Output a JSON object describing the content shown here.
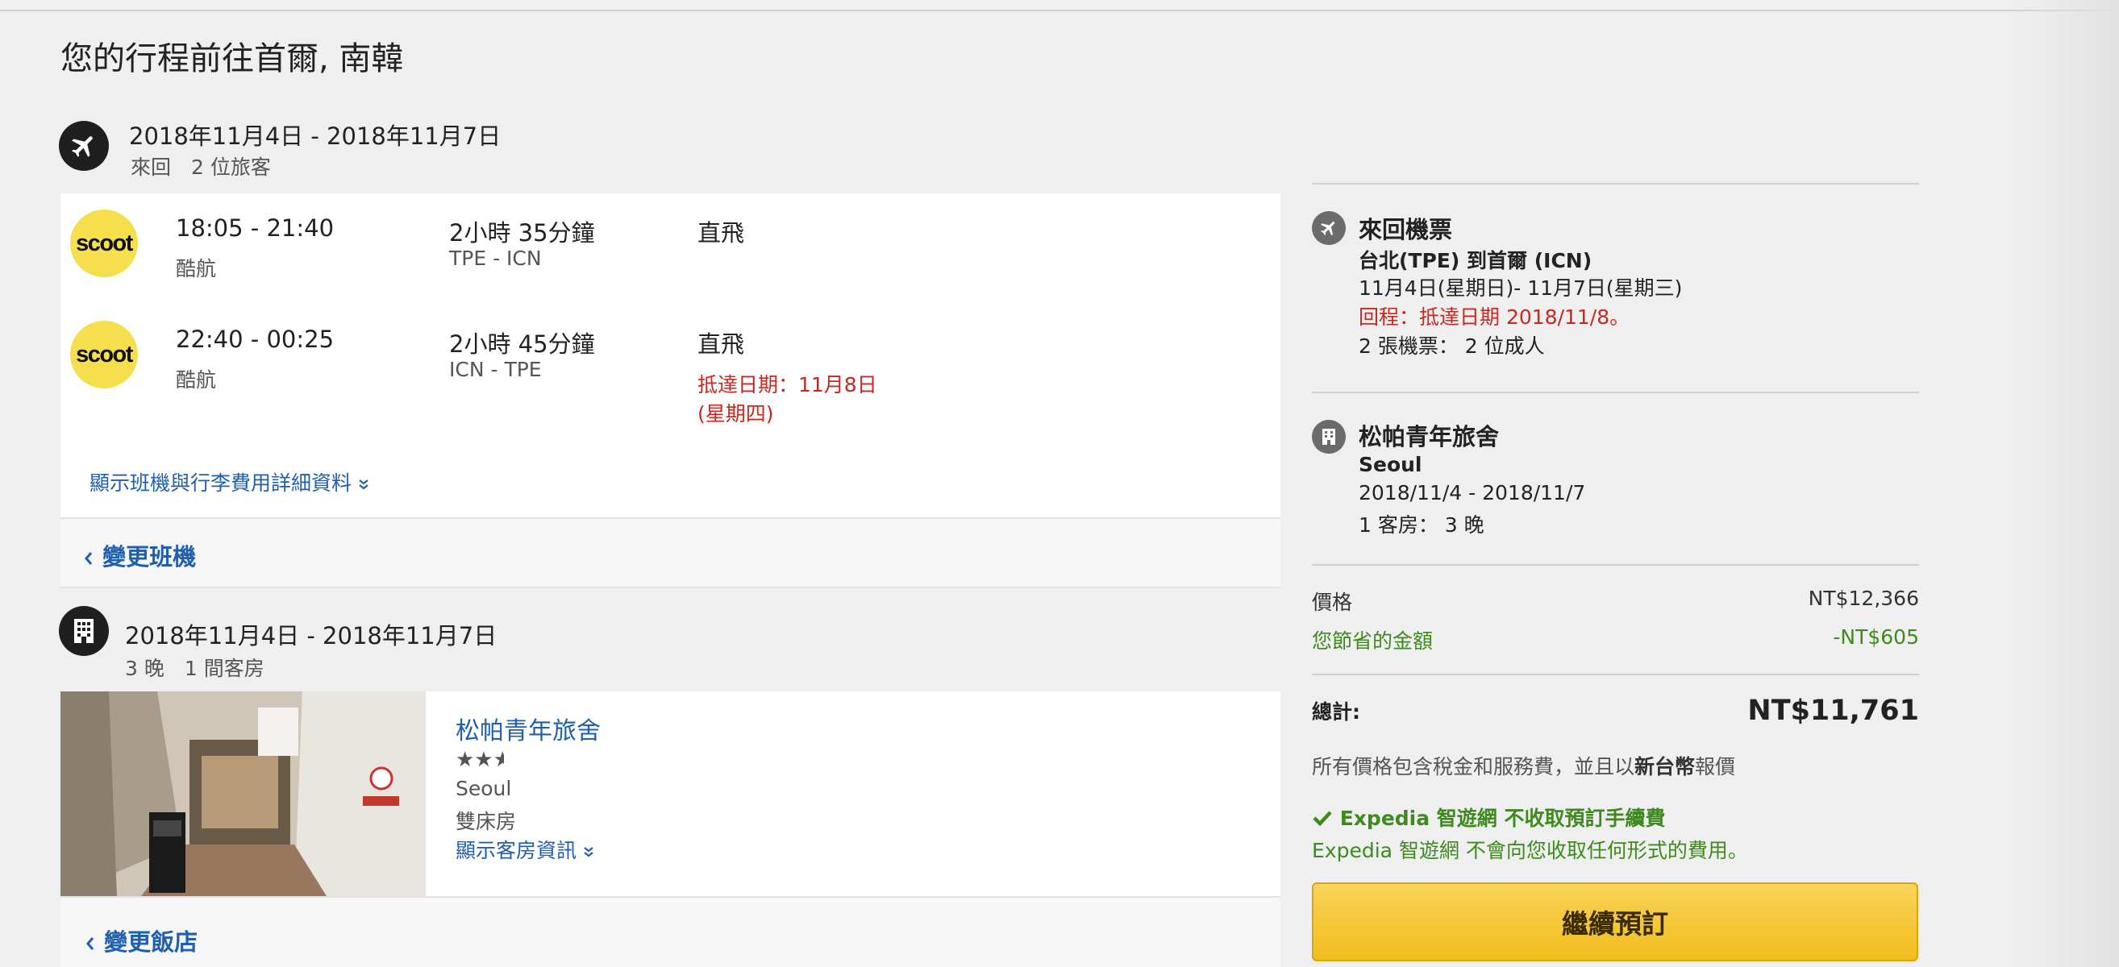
{
  "page": {
    "title": "您的行程前往首爾, 南韓"
  },
  "flight_section": {
    "dates": "2018年11月4日 - 2018年11月7日",
    "sub": "來回　2 位旅客",
    "legs": [
      {
        "times": "18:05 - 21:40",
        "airline": "酷航",
        "duration": "2小時 35分鐘",
        "route": "TPE - ICN",
        "stops": "直飛",
        "logo_text": "scoot"
      },
      {
        "times": "22:40 - 00:25",
        "airline": "酷航",
        "duration": "2小時 45分鐘",
        "route": "ICN - TPE",
        "stops": "直飛",
        "logo_text": "scoot",
        "arrival_note_1": "抵達日期：11月8日",
        "arrival_note_2": "(星期四)"
      }
    ],
    "details_link": "顯示班機與行李費用詳細資料",
    "change_label": "變更班機"
  },
  "hotel_section": {
    "dates": "2018年11月4日 - 2018年11月7日",
    "sub": "3 晚　1 間客房",
    "hotel_name": "松帕青年旅舍",
    "star_rating": 2.5,
    "stars_display": "★★",
    "city": "Seoul",
    "room_type": "雙床房",
    "room_link": "顯示客房資訊",
    "change_label": "變更飯店"
  },
  "summary": {
    "flight": {
      "title": "來回機票",
      "route": "台北(TPE) 到首爾 (ICN)",
      "dates": "11月4日(星期日)- 11月7日(星期三)",
      "return_note": "回程：抵達日期 2018/11/8。",
      "tickets": "2 張機票： 2 位成人"
    },
    "hotel": {
      "title": "松帕青年旅舍",
      "city": "Seoul",
      "dates": "2018/11/4 - 2018/11/7",
      "rooms": "1 客房： 3 晚"
    },
    "price_label": "價格",
    "price_value": "NT$12,366",
    "savings_label": "您節省的金額",
    "savings_value": "-NT$605",
    "total_label": "總計:",
    "total_value": "NT$11,761",
    "tax_note_1": "所有價格包含稅金和服務費，並且以",
    "tax_note_bold": "新台幣",
    "tax_note_2": "報價",
    "fee_title": "Expedia 智遊網 不收取預訂手續費",
    "fee_text": "Expedia 智遊網 不會向您收取任何形式的費用。",
    "cta_label": "繼續預訂"
  },
  "colors": {
    "link": "#1f5fad",
    "red": "#c8281e",
    "green": "#3f8a1f",
    "cta": "#f3c12c",
    "scoot": "#f5df4d"
  }
}
